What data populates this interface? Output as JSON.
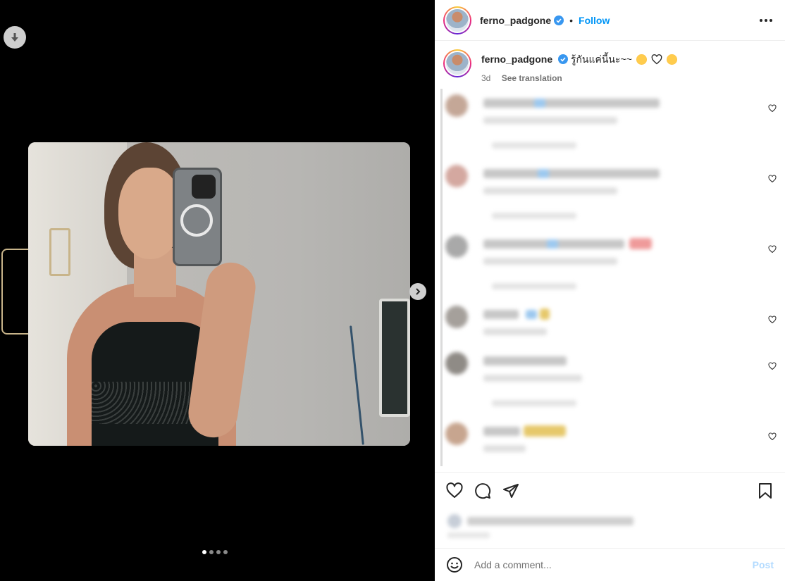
{
  "post": {
    "username": "ferno_padgone",
    "caption": "รู้กันแค่นี้นะ~~",
    "age": "3d",
    "see_translation": "See translation",
    "follow_label": "Follow",
    "separator": "•"
  },
  "composer": {
    "placeholder": "Add a comment...",
    "post_label": "Post"
  },
  "colors": {
    "accent": "#0095f6",
    "post_disabled": "#b3dbff",
    "verified": "#3897f0"
  },
  "icons": {
    "download": "download-icon",
    "next": "chevron-right-icon",
    "more": "more-icon",
    "like": "heart-icon",
    "comment": "comment-icon",
    "share": "send-icon",
    "save": "bookmark-icon",
    "emoji": "emoji-icon"
  },
  "carousel": {
    "slide": 1,
    "slides": 4
  }
}
